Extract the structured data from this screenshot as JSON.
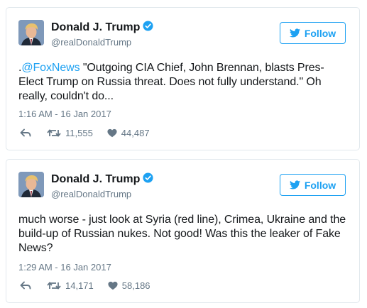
{
  "tweets": [
    {
      "author_name": "Donald J. Trump",
      "author_handle": "@realDonaldTrump",
      "follow_label": "Follow",
      "text_prefix": ".",
      "mention": "@FoxNews",
      "text": " \"Outgoing CIA Chief, John Brennan, blasts Pres-Elect Trump on Russia threat. Does not fully understand.\" Oh really, couldn't do...",
      "timestamp": "1:16 AM - 16 Jan 2017",
      "retweets": "11,555",
      "likes": "44,487"
    },
    {
      "author_name": "Donald J. Trump",
      "author_handle": "@realDonaldTrump",
      "follow_label": "Follow",
      "text_prefix": "",
      "mention": "",
      "text": "much worse - just look at Syria (red line), Crimea, Ukraine and the build-up of Russian nukes. Not good! Was this the leaker of Fake News?",
      "timestamp": "1:29 AM - 16 Jan 2017",
      "retweets": "14,171",
      "likes": "58,186"
    }
  ],
  "colors": {
    "accent": "#1da1f2",
    "secondary_text": "#657786",
    "border": "#e1e8ed"
  },
  "icons": [
    "verified-badge-icon",
    "twitter-bird-icon",
    "reply-icon",
    "retweet-icon",
    "heart-icon"
  ]
}
